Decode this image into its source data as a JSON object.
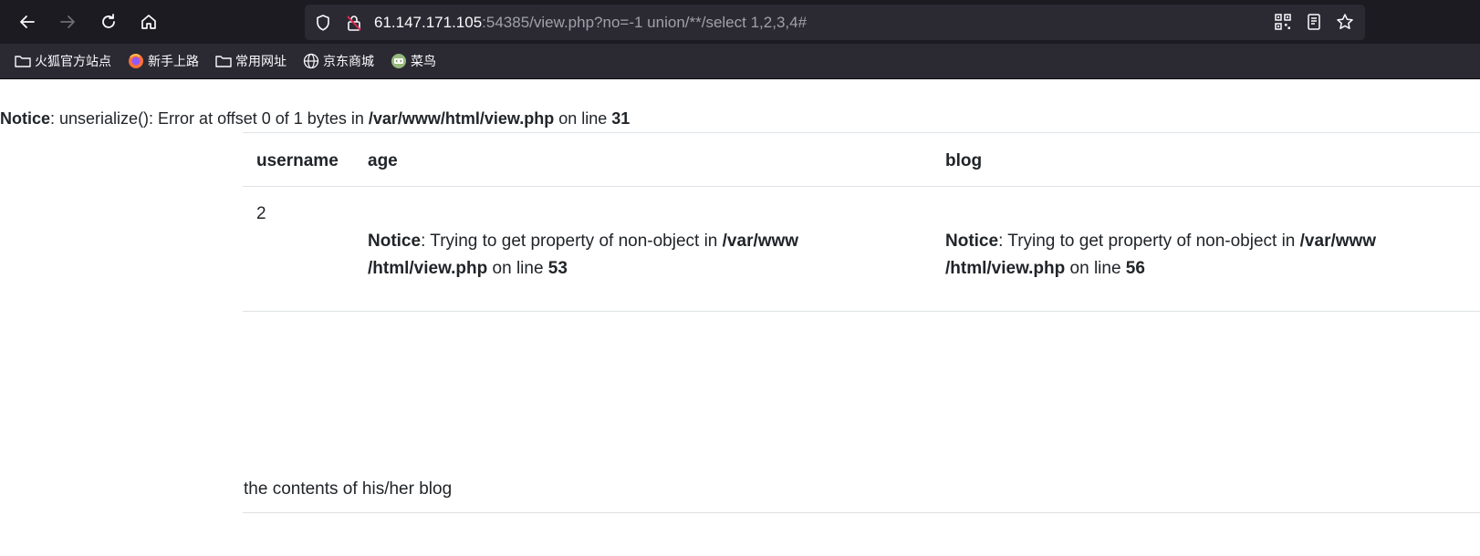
{
  "browser": {
    "url_host": "61.147.171.105",
    "url_rest": ":54385/view.php?no=-1 union/**/select 1,2,3,4#",
    "bookmarks": [
      {
        "label": "火狐官方站点",
        "icon": "folder-icon"
      },
      {
        "label": "新手上路",
        "icon": "firefox-icon"
      },
      {
        "label": "常用网址",
        "icon": "folder-icon"
      },
      {
        "label": "京东商城",
        "icon": "globe-icon"
      },
      {
        "label": "菜鸟",
        "icon": "runoob-icon"
      }
    ]
  },
  "page": {
    "notice_top": {
      "label": "Notice",
      "message": ": unserialize(): Error at offset 0 of 1 bytes in ",
      "path": "/var/www/html/view.php",
      "on_line": " on line ",
      "line": "31"
    },
    "table": {
      "headers": [
        "username",
        "age",
        "blog"
      ],
      "username_value": "2",
      "age_notice": {
        "label": "Notice",
        "message": ": Trying to get property of non-object in ",
        "path_1": "/var/www",
        "path_2": "/html/view.php",
        "on_line": " on line ",
        "line": "53"
      },
      "blog_notice": {
        "label": "Notice",
        "message": ": Trying to get property of non-object in ",
        "path_1": "/var/www",
        "path_2": "/html/view.php",
        "on_line": " on line ",
        "line": "56"
      }
    },
    "blog_contents": "the contents of his/her blog"
  }
}
